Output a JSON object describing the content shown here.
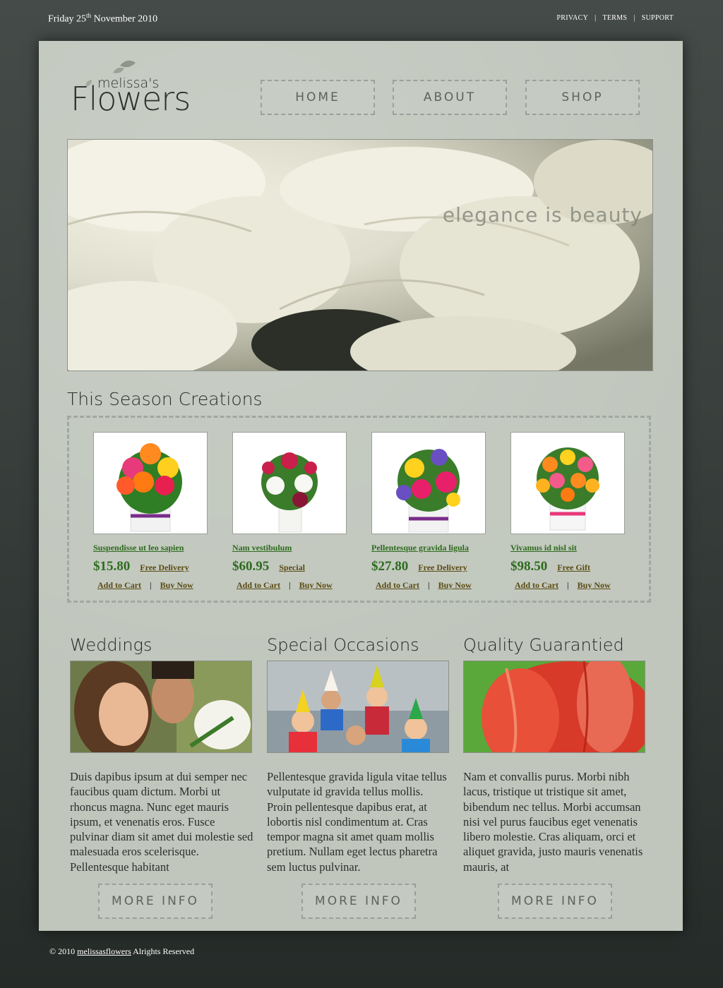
{
  "header": {
    "date_prefix": "Friday 25",
    "date_sup": "th",
    "date_suffix": " November 2010",
    "links": [
      "PRIVACY",
      "TERMS",
      "SUPPORT"
    ]
  },
  "logo": {
    "small": "melissa's",
    "big": "Flowers"
  },
  "nav": [
    "HOME",
    "ABOUT",
    "SHOP"
  ],
  "hero": {
    "tagline": "elegance  is beauty"
  },
  "season": {
    "title": "This Season Creations",
    "add_to_cart": "Add to Cart",
    "buy_now": "Buy Now",
    "products": [
      {
        "name": "Suspendisse ut leo sapien",
        "price": "$15.80",
        "tag": "Free Delivery"
      },
      {
        "name": "Nam vestibulum",
        "price": "$60.95",
        "tag": "Special"
      },
      {
        "name": "Pellentesque gravida ligula",
        "price": "$27.80",
        "tag": "Free Delivery"
      },
      {
        "name": "Vivamus id nisl sit",
        "price": "$98.50",
        "tag": "Free Gift"
      }
    ]
  },
  "features": [
    {
      "title": "Weddings",
      "text": "Duis dapibus ipsum at dui semper nec faucibus quam dictum. Morbi ut rhoncus magna. Nunc eget mauris ipsum, et venenatis eros. Fusce pulvinar diam sit amet dui molestie sed malesuada eros scelerisque. Pellentesque habitant"
    },
    {
      "title": "Special Occasions",
      "text": "Pellentesque gravida ligula vitae tellus vulputate id gravida tellus mollis. Proin pellentesque dapibus erat, at lobortis nisl condimentum at. Cras tempor magna sit amet quam mollis pretium. Nullam eget lectus pharetra sem luctus pulvinar."
    },
    {
      "title": "Quality Guarantied",
      "text": "Nam et convallis purus. Morbi nibh lacus, tristique ut tristique sit amet, bibendum nec tellus. Morbi accumsan nisi vel purus faucibus eget venenatis libero molestie. Cras aliquam, orci et aliquet gravida, justo mauris venenatis mauris, at"
    }
  ],
  "more_info": "MORE INFO",
  "footer": {
    "prefix": "© 2010 ",
    "link": "melissasflowers",
    "suffix": "  Alrights Reserved"
  }
}
